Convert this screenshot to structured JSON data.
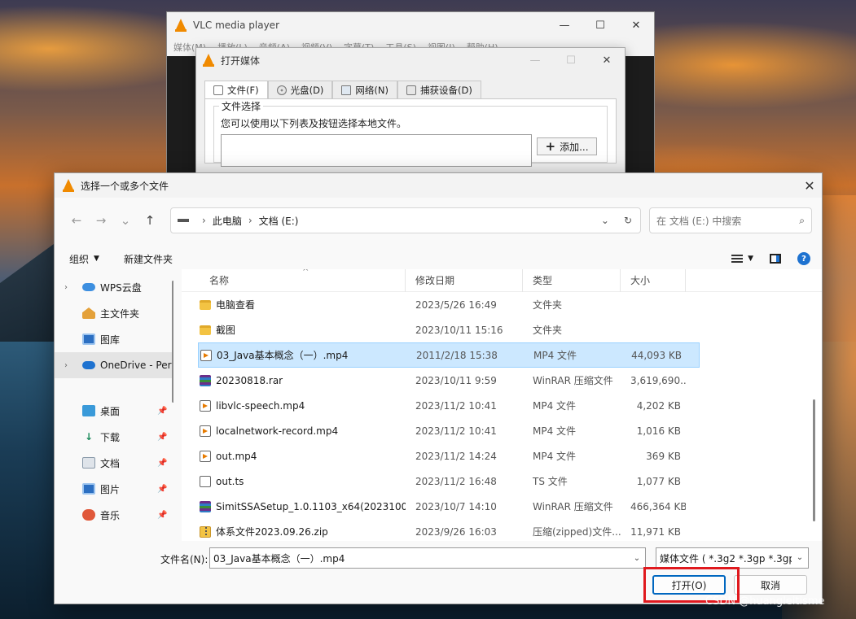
{
  "desktop": {
    "watermark": "CSDN @huangleitisme"
  },
  "vlc_main": {
    "title": "VLC media player",
    "menu": [
      "媒体(M)",
      "播放(L)",
      "音频(A)",
      "视频(V)",
      "字幕(T)",
      "工具(S)",
      "视图(I)",
      "帮助(H)"
    ],
    "controls": {
      "minimize": "—",
      "maximize": "☐",
      "close": "✕"
    }
  },
  "open_media": {
    "title": "打开媒体",
    "tabs": [
      {
        "label": "文件(F)",
        "icon": "file-icon",
        "active": true
      },
      {
        "label": "光盘(D)",
        "icon": "disc-icon",
        "active": false
      },
      {
        "label": "网络(N)",
        "icon": "network-icon",
        "active": false
      },
      {
        "label": "捕获设备(D)",
        "icon": "capture-icon",
        "active": false
      }
    ],
    "group_title": "文件选择",
    "hint": "您可以使用以下列表及按钮选择本地文件。",
    "add_button": "添加..."
  },
  "picker": {
    "title": "选择一个或多个文件",
    "close": "✕",
    "address": {
      "root": "此电脑",
      "folder": "文档 (E:)"
    },
    "search_placeholder": "在 文档 (E:) 中搜索",
    "toolbar": {
      "organize": "组织",
      "new_folder": "新建文件夹"
    },
    "sidebar": [
      {
        "label": "WPS云盘",
        "icon": "cloud-icon",
        "expandable": true
      },
      {
        "label": "主文件夹",
        "icon": "home-icon",
        "expandable": false
      },
      {
        "label": "图库",
        "icon": "gallery-icon",
        "expandable": false
      },
      {
        "label": "OneDrive - Per",
        "icon": "onedrive-icon",
        "expandable": true,
        "selected": true
      },
      {
        "label": "桌面",
        "icon": "desktop-icon",
        "pinned": true
      },
      {
        "label": "下载",
        "icon": "download-icon",
        "pinned": true
      },
      {
        "label": "文档",
        "icon": "documents-icon",
        "pinned": true
      },
      {
        "label": "图片",
        "icon": "pictures-icon",
        "pinned": true
      },
      {
        "label": "音乐",
        "icon": "music-icon",
        "pinned": true
      }
    ],
    "columns": {
      "name": "名称",
      "date": "修改日期",
      "type": "类型",
      "size": "大小"
    },
    "files": [
      {
        "name": "电脑查看",
        "date": "2023/5/26 16:49",
        "type": "文件夹",
        "size": "",
        "icon": "folder-icon"
      },
      {
        "name": "截图",
        "date": "2023/10/11 15:16",
        "type": "文件夹",
        "size": "",
        "icon": "folder-icon"
      },
      {
        "name": "03_Java基本概念（一）.mp4",
        "date": "2011/2/18 15:38",
        "type": "MP4 文件",
        "size": "44,093 KB",
        "icon": "video-file-icon",
        "selected": true
      },
      {
        "name": "20230818.rar",
        "date": "2023/10/11 9:59",
        "type": "WinRAR 压缩文件",
        "size": "3,619,690...",
        "icon": "rar-file-icon"
      },
      {
        "name": "libvlc-speech.mp4",
        "date": "2023/11/2 10:41",
        "type": "MP4 文件",
        "size": "4,202 KB",
        "icon": "video-file-icon"
      },
      {
        "name": "localnetwork-record.mp4",
        "date": "2023/11/2 10:41",
        "type": "MP4 文件",
        "size": "1,016 KB",
        "icon": "video-file-icon"
      },
      {
        "name": "out.mp4",
        "date": "2023/11/2 14:24",
        "type": "MP4 文件",
        "size": "369 KB",
        "icon": "video-file-icon"
      },
      {
        "name": "out.ts",
        "date": "2023/11/2 16:48",
        "type": "TS 文件",
        "size": "1,077 KB",
        "icon": "ts-file-icon"
      },
      {
        "name": "SimitSSASetup_1.0.1103_x64(2023100...",
        "date": "2023/10/7 14:10",
        "type": "WinRAR 压缩文件",
        "size": "466,364 KB",
        "icon": "rar-file-icon"
      },
      {
        "name": "体系文件2023.09.26.zip",
        "date": "2023/9/26 16:03",
        "type": "压缩(zipped)文件...",
        "size": "11,971 KB",
        "icon": "zip-file-icon"
      }
    ],
    "filename_label": "文件名(N):",
    "filename_value": "03_Java基本概念（一）.mp4",
    "filetype_value": "媒体文件 ( *.3g2 *.3gp *.3gp2",
    "open_button": "打开(O)",
    "cancel_button": "取消"
  }
}
